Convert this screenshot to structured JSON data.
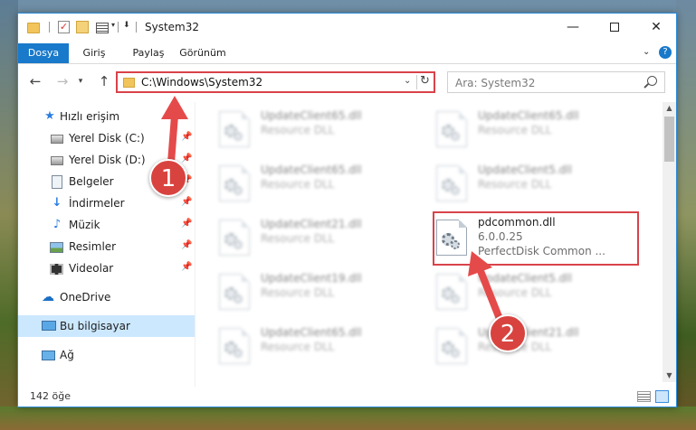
{
  "window": {
    "title": "System32",
    "controls": {
      "minimize": "—",
      "maximize": "",
      "close": "✕"
    }
  },
  "ribbon": {
    "tabs": [
      "Dosya",
      "Giriş",
      "Paylaş",
      "Görünüm"
    ],
    "help": "?"
  },
  "navigation": {
    "address": "C:\\Windows\\System32",
    "search_placeholder": "Ara: System32"
  },
  "sidebar": {
    "items": [
      {
        "label": "Hızlı erişim",
        "icon": "star-icon",
        "pinned": false
      },
      {
        "label": "Yerel Disk (C:)",
        "icon": "drive-icon",
        "pinned": true
      },
      {
        "label": "Yerel Disk (D:)",
        "icon": "drive-icon",
        "pinned": true
      },
      {
        "label": "Belgeler",
        "icon": "documents-icon",
        "pinned": true
      },
      {
        "label": "İndirmeler",
        "icon": "download-icon",
        "pinned": true
      },
      {
        "label": "Müzik",
        "icon": "music-icon",
        "pinned": true
      },
      {
        "label": "Resimler",
        "icon": "pictures-icon",
        "pinned": true
      },
      {
        "label": "Videolar",
        "icon": "videos-icon",
        "pinned": true
      },
      {
        "label": "OneDrive",
        "icon": "cloud-icon",
        "pinned": false
      },
      {
        "label": "Bu bilgisayar",
        "icon": "computer-icon",
        "pinned": false,
        "selected": true
      },
      {
        "label": "Ağ",
        "icon": "network-icon",
        "pinned": false
      }
    ]
  },
  "files": [
    {
      "name": "UpdateClient65.dll",
      "desc": "Resource DLL",
      "highlighted": false
    },
    {
      "name": "UpdateClient65.dll",
      "desc": "Resource DLL",
      "highlighted": false
    },
    {
      "name": "UpdateClient65.dll",
      "desc": "Resource DLL",
      "highlighted": false
    },
    {
      "name": "UpdateClient5.dll",
      "desc": "Resource DLL",
      "highlighted": false
    },
    {
      "name": "UpdateClient21.dll",
      "desc": "Resource DLL",
      "highlighted": false
    },
    {
      "name": "pdcommon.dll",
      "version": "6.0.0.25",
      "desc": "PerfectDisk Common ...",
      "highlighted": true
    },
    {
      "name": "UpdateClient19.dll",
      "desc": "Resource DLL",
      "highlighted": false
    },
    {
      "name": "UpdateClient5.dll",
      "desc": "Resource DLL",
      "highlighted": false
    },
    {
      "name": "UpdateClient65.dll",
      "desc": "Resource DLL",
      "highlighted": false
    },
    {
      "name": "UpdateClient21.dll",
      "desc": "Resource DLL",
      "highlighted": false
    }
  ],
  "status": {
    "item_count": "142 öğe"
  },
  "annotations": {
    "step1": "1",
    "step2": "2"
  },
  "colors": {
    "accent": "#1979ca",
    "highlight_border": "#d9434a",
    "badge": "#d8433f"
  }
}
